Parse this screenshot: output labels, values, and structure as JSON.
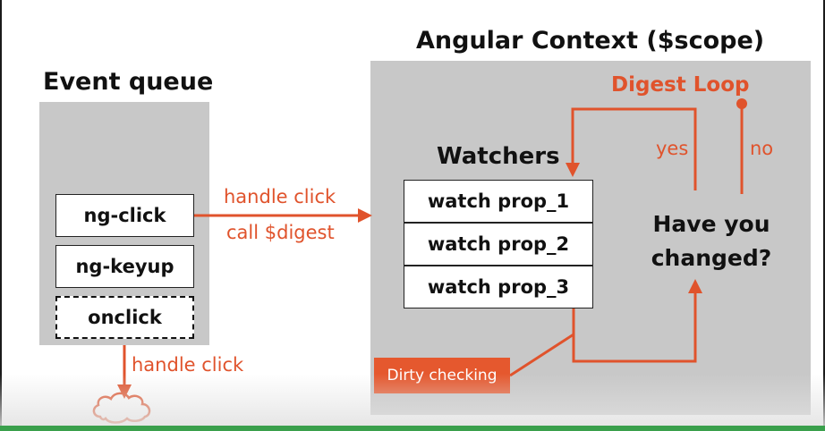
{
  "event_queue": {
    "title": "Event queue",
    "items": [
      "ng-click",
      "ng-keyup",
      "onclick"
    ]
  },
  "angular_context": {
    "title": "Angular Context ($scope)",
    "watchers_title": "Watchers",
    "watchers": [
      "watch prop_1",
      "watch prop_2",
      "watch prop_3"
    ],
    "decision": [
      "Have you",
      "changed?"
    ],
    "digest_loop": "Digest Loop",
    "yes": "yes",
    "no": "no",
    "dirty_checking": "Dirty checking"
  },
  "arrows": {
    "handle_click": "handle click",
    "call_digest": "call $digest",
    "handle_click_native": "handle click"
  },
  "colors": {
    "accent": "#e0532c",
    "panel": "#c8c8c8",
    "badge": "#e5582e"
  }
}
